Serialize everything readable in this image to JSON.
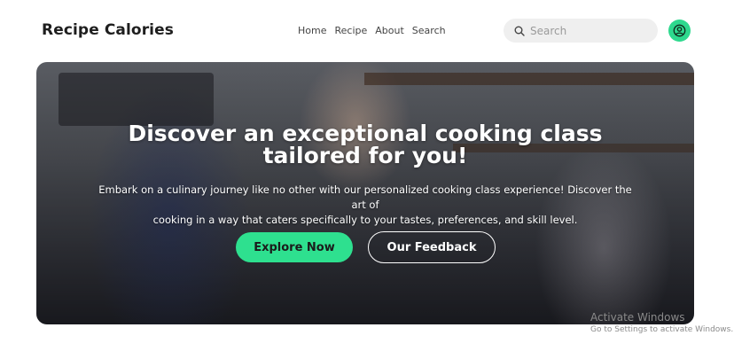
{
  "header": {
    "logo": "Recipe Calories",
    "nav": [
      "Home",
      "Recipe",
      "About",
      "Search"
    ],
    "search_placeholder": "Search"
  },
  "hero": {
    "title_line1": "Discover an exceptional cooking class",
    "title_line2": "tailored for you!",
    "desc_line1": "Embark on a culinary journey like no other with our personalized cooking class experience! Discover the art of",
    "desc_line2": "cooking in a way that caters specifically to your tastes, preferences, and skill level.",
    "primary_button": "Explore Now",
    "secondary_button": "Our Feedback"
  },
  "watermark": {
    "title": "Activate Windows",
    "subtitle": "Go to Settings to activate Windows."
  },
  "colors": {
    "accent": "#2ee08f",
    "search_bg": "#efefef"
  },
  "icons": {
    "search": "search-icon",
    "profile": "user-circle-icon"
  }
}
